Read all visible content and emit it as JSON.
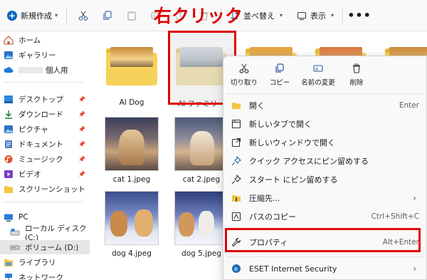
{
  "annotation": "右クリック",
  "toolbar": {
    "new_label": "新規作成",
    "sort_label": "並べ替え",
    "view_label": "表示",
    "more_label": "•••"
  },
  "sidebar": {
    "items": [
      {
        "label": "ホーム",
        "icon": "home-icon"
      },
      {
        "label": "ギャラリー",
        "icon": "gallery-icon"
      },
      {
        "label": "個人用",
        "icon": "cloud-icon"
      },
      {
        "label": "デスクトップ",
        "icon": "desktop-icon"
      },
      {
        "label": "ダウンロード",
        "icon": "download-icon"
      },
      {
        "label": "ピクチャ",
        "icon": "pictures-icon"
      },
      {
        "label": "ドキュメント",
        "icon": "documents-icon"
      },
      {
        "label": "ミュージック",
        "icon": "music-icon"
      },
      {
        "label": "ビデオ",
        "icon": "video-icon"
      },
      {
        "label": "スクリーンショット",
        "icon": "folder-icon"
      },
      {
        "label": "PC",
        "icon": "pc-icon"
      },
      {
        "label": "ローカル ディスク (C:)",
        "icon": "disk-icon"
      },
      {
        "label": "ボリューム (D:)",
        "icon": "disk-icon"
      },
      {
        "label": "ライブラリ",
        "icon": "library-icon"
      },
      {
        "label": "ネットワーク",
        "icon": "network-icon"
      }
    ]
  },
  "files": [
    {
      "name": "AI Dog",
      "type": "folder"
    },
    {
      "name": "AI ファミリー",
      "type": "folder"
    },
    {
      "name": "cat 1.jpeg",
      "type": "image"
    },
    {
      "name": "cat 2.jpeg",
      "type": "image"
    },
    {
      "name": "dog 4.jpeg",
      "type": "image"
    },
    {
      "name": "dog 5.jpeg",
      "type": "image"
    }
  ],
  "context_menu": {
    "quick_actions": [
      {
        "label": "切り取り",
        "icon": "scissors-icon"
      },
      {
        "label": "コピー",
        "icon": "copy-icon"
      },
      {
        "label": "名前の変更",
        "icon": "rename-icon"
      },
      {
        "label": "削除",
        "icon": "trash-icon"
      }
    ],
    "items": [
      {
        "label": "開く",
        "shortcut": "Enter",
        "icon": "open-icon"
      },
      {
        "label": "新しいタブで開く",
        "shortcut": "",
        "icon": "new-tab-icon"
      },
      {
        "label": "新しいウィンドウで開く",
        "shortcut": "",
        "icon": "new-window-icon"
      },
      {
        "label": "クイック アクセスにピン留めする",
        "shortcut": "",
        "icon": "pin-icon"
      },
      {
        "label": "スタート にピン留めする",
        "shortcut": "",
        "icon": "pin-start-icon"
      },
      {
        "label": "圧縮先...",
        "shortcut": "",
        "icon": "zip-icon"
      },
      {
        "label": "パスのコピー",
        "shortcut": "Ctrl+Shift+C",
        "icon": "path-copy-icon"
      },
      {
        "label": "プロパティ",
        "shortcut": "Alt+Enter",
        "icon": "wrench-icon"
      },
      {
        "label": "ESET Internet Security",
        "shortcut": "",
        "icon": "eset-icon"
      }
    ]
  }
}
